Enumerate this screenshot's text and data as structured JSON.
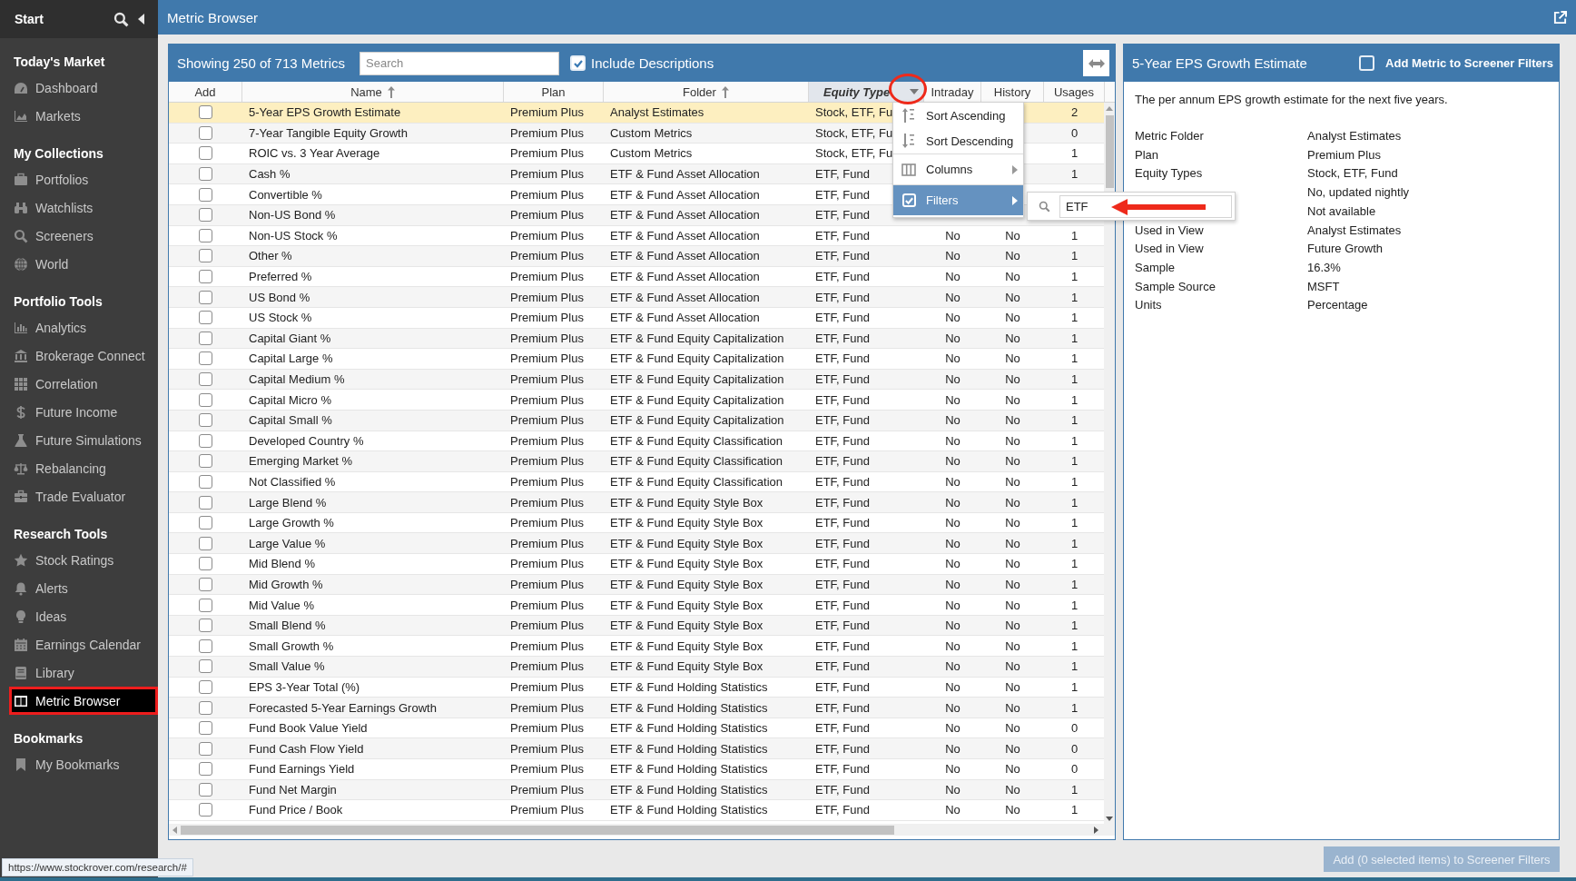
{
  "app_bar": {
    "title": "Metric Browser"
  },
  "sidebar": {
    "header": "Start",
    "sections": [
      {
        "title": "Today's Market",
        "items": [
          {
            "label": "Dashboard",
            "selected": false
          },
          {
            "label": "Markets",
            "selected": false
          }
        ]
      },
      {
        "title": "My Collections",
        "items": [
          {
            "label": "Portfolios",
            "selected": false
          },
          {
            "label": "Watchlists",
            "selected": false
          },
          {
            "label": "Screeners",
            "selected": false
          },
          {
            "label": "World",
            "selected": false
          }
        ]
      },
      {
        "title": "Portfolio Tools",
        "items": [
          {
            "label": "Analytics",
            "selected": false
          },
          {
            "label": "Brokerage Connect",
            "selected": false
          },
          {
            "label": "Correlation",
            "selected": false
          },
          {
            "label": "Future Income",
            "selected": false
          },
          {
            "label": "Future Simulations",
            "selected": false
          },
          {
            "label": "Rebalancing",
            "selected": false
          },
          {
            "label": "Trade Evaluator",
            "selected": false
          }
        ]
      },
      {
        "title": "Research Tools",
        "items": [
          {
            "label": "Stock Ratings",
            "selected": false
          },
          {
            "label": "Alerts",
            "selected": false
          },
          {
            "label": "Ideas",
            "selected": false
          },
          {
            "label": "Earnings Calendar",
            "selected": false
          },
          {
            "label": "Library",
            "selected": false
          },
          {
            "label": "Metric Browser",
            "selected": true
          }
        ]
      },
      {
        "title": "Bookmarks",
        "items": [
          {
            "label": "My Bookmarks",
            "selected": false
          }
        ]
      }
    ]
  },
  "metrics_panel": {
    "count_text": "Showing 250 of 713 Metrics",
    "search": {
      "placeholder": "Search"
    },
    "include_descriptions": {
      "label": "Include Descriptions",
      "checked": true
    },
    "columns": [
      {
        "label": "Add",
        "sorted": false,
        "active": false
      },
      {
        "label": "Name",
        "sorted": true,
        "active": false
      },
      {
        "label": "Plan",
        "sorted": false,
        "active": false
      },
      {
        "label": "Folder",
        "sorted": true,
        "active": false
      },
      {
        "label": "Equity Type",
        "sorted": false,
        "active": true
      },
      {
        "label": "Intraday",
        "sorted": false,
        "active": false
      },
      {
        "label": "History",
        "sorted": false,
        "active": false
      },
      {
        "label": "Usages",
        "sorted": false,
        "active": false
      }
    ],
    "rows": [
      {
        "checked": false,
        "selected": true,
        "name": "5-Year EPS Growth Estimate",
        "plan": "Premium Plus",
        "folder": "Analyst Estimates",
        "equity_type": "Stock, ETF, Fu",
        "usages": "2"
      },
      {
        "checked": false,
        "selected": false,
        "name": "7-Year Tangible Equity Growth",
        "plan": "Premium Plus",
        "folder": "Custom Metrics",
        "equity_type": "Stock, ETF, Fu",
        "usages": "0"
      },
      {
        "checked": false,
        "selected": false,
        "name": "ROIC vs. 3 Year Average",
        "plan": "Premium Plus",
        "folder": "Custom Metrics",
        "equity_type": "Stock, ETF, Fu",
        "usages": "1"
      },
      {
        "checked": false,
        "selected": false,
        "name": "Cash %",
        "plan": "Premium Plus",
        "folder": "ETF & Fund Asset Allocation",
        "equity_type": "ETF, Fund",
        "usages": "1"
      },
      {
        "checked": false,
        "selected": false,
        "name": "Convertible %",
        "plan": "Premium Plus",
        "folder": "ETF & Fund Asset Allocation",
        "equity_type": "ETF, Fund"
      },
      {
        "checked": false,
        "selected": false,
        "name": "Non-US Bond %",
        "plan": "Premium Plus",
        "folder": "ETF & Fund Asset Allocation",
        "equity_type": "ETF, Fund"
      },
      {
        "checked": false,
        "selected": false,
        "name": "Non-US Stock %",
        "plan": "Premium Plus",
        "folder": "ETF & Fund Asset Allocation",
        "equity_type": "ETF, Fund",
        "intraday": "No",
        "history": "No",
        "usages": "1"
      },
      {
        "checked": false,
        "selected": false,
        "name": "Other %",
        "plan": "Premium Plus",
        "folder": "ETF & Fund Asset Allocation",
        "equity_type": "ETF, Fund",
        "intraday": "No",
        "history": "No",
        "usages": "1"
      },
      {
        "checked": false,
        "selected": false,
        "name": "Preferred %",
        "plan": "Premium Plus",
        "folder": "ETF & Fund Asset Allocation",
        "equity_type": "ETF, Fund",
        "intraday": "No",
        "history": "No",
        "usages": "1"
      },
      {
        "checked": false,
        "selected": false,
        "name": "US Bond %",
        "plan": "Premium Plus",
        "folder": "ETF & Fund Asset Allocation",
        "equity_type": "ETF, Fund",
        "intraday": "No",
        "history": "No",
        "usages": "1"
      },
      {
        "checked": false,
        "selected": false,
        "name": "US Stock %",
        "plan": "Premium Plus",
        "folder": "ETF & Fund Asset Allocation",
        "equity_type": "ETF, Fund",
        "intraday": "No",
        "history": "No",
        "usages": "1"
      },
      {
        "checked": false,
        "selected": false,
        "name": "Capital Giant %",
        "plan": "Premium Plus",
        "folder": "ETF & Fund Equity Capitalization",
        "equity_type": "ETF, Fund",
        "intraday": "No",
        "history": "No",
        "usages": "1"
      },
      {
        "checked": false,
        "selected": false,
        "name": "Capital Large %",
        "plan": "Premium Plus",
        "folder": "ETF & Fund Equity Capitalization",
        "equity_type": "ETF, Fund",
        "intraday": "No",
        "history": "No",
        "usages": "1"
      },
      {
        "checked": false,
        "selected": false,
        "name": "Capital Medium %",
        "plan": "Premium Plus",
        "folder": "ETF & Fund Equity Capitalization",
        "equity_type": "ETF, Fund",
        "intraday": "No",
        "history": "No",
        "usages": "1"
      },
      {
        "checked": false,
        "selected": false,
        "name": "Capital Micro %",
        "plan": "Premium Plus",
        "folder": "ETF & Fund Equity Capitalization",
        "equity_type": "ETF, Fund",
        "intraday": "No",
        "history": "No",
        "usages": "1"
      },
      {
        "checked": false,
        "selected": false,
        "name": "Capital Small %",
        "plan": "Premium Plus",
        "folder": "ETF & Fund Equity Capitalization",
        "equity_type": "ETF, Fund",
        "intraday": "No",
        "history": "No",
        "usages": "1"
      },
      {
        "checked": false,
        "selected": false,
        "name": "Developed Country %",
        "plan": "Premium Plus",
        "folder": "ETF & Fund Equity Classification",
        "equity_type": "ETF, Fund",
        "intraday": "No",
        "history": "No",
        "usages": "1"
      },
      {
        "checked": false,
        "selected": false,
        "name": "Emerging Market %",
        "plan": "Premium Plus",
        "folder": "ETF & Fund Equity Classification",
        "equity_type": "ETF, Fund",
        "intraday": "No",
        "history": "No",
        "usages": "1"
      },
      {
        "checked": false,
        "selected": false,
        "name": "Not Classified %",
        "plan": "Premium Plus",
        "folder": "ETF & Fund Equity Classification",
        "equity_type": "ETF, Fund",
        "intraday": "No",
        "history": "No",
        "usages": "1"
      },
      {
        "checked": false,
        "selected": false,
        "name": "Large Blend %",
        "plan": "Premium Plus",
        "folder": "ETF & Fund Equity Style Box",
        "equity_type": "ETF, Fund",
        "intraday": "No",
        "history": "No",
        "usages": "1"
      },
      {
        "checked": false,
        "selected": false,
        "name": "Large Growth %",
        "plan": "Premium Plus",
        "folder": "ETF & Fund Equity Style Box",
        "equity_type": "ETF, Fund",
        "intraday": "No",
        "history": "No",
        "usages": "1"
      },
      {
        "checked": false,
        "selected": false,
        "name": "Large Value %",
        "plan": "Premium Plus",
        "folder": "ETF & Fund Equity Style Box",
        "equity_type": "ETF, Fund",
        "intraday": "No",
        "history": "No",
        "usages": "1"
      },
      {
        "checked": false,
        "selected": false,
        "name": "Mid Blend %",
        "plan": "Premium Plus",
        "folder": "ETF & Fund Equity Style Box",
        "equity_type": "ETF, Fund",
        "intraday": "No",
        "history": "No",
        "usages": "1"
      },
      {
        "checked": false,
        "selected": false,
        "name": "Mid Growth %",
        "plan": "Premium Plus",
        "folder": "ETF & Fund Equity Style Box",
        "equity_type": "ETF, Fund",
        "intraday": "No",
        "history": "No",
        "usages": "1"
      },
      {
        "checked": false,
        "selected": false,
        "name": "Mid Value %",
        "plan": "Premium Plus",
        "folder": "ETF & Fund Equity Style Box",
        "equity_type": "ETF, Fund",
        "intraday": "No",
        "history": "No",
        "usages": "1"
      },
      {
        "checked": false,
        "selected": false,
        "name": "Small Blend %",
        "plan": "Premium Plus",
        "folder": "ETF & Fund Equity Style Box",
        "equity_type": "ETF, Fund",
        "intraday": "No",
        "history": "No",
        "usages": "1"
      },
      {
        "checked": false,
        "selected": false,
        "name": "Small Growth %",
        "plan": "Premium Plus",
        "folder": "ETF & Fund Equity Style Box",
        "equity_type": "ETF, Fund",
        "intraday": "No",
        "history": "No",
        "usages": "1"
      },
      {
        "checked": false,
        "selected": false,
        "name": "Small Value %",
        "plan": "Premium Plus",
        "folder": "ETF & Fund Equity Style Box",
        "equity_type": "ETF, Fund",
        "intraday": "No",
        "history": "No",
        "usages": "1"
      },
      {
        "checked": false,
        "selected": false,
        "name": "EPS 3-Year Total (%)",
        "plan": "Premium Plus",
        "folder": "ETF & Fund Holding Statistics",
        "equity_type": "ETF, Fund",
        "intraday": "No",
        "history": "No",
        "usages": "1"
      },
      {
        "checked": false,
        "selected": false,
        "name": "Forecasted 5-Year Earnings Growth",
        "plan": "Premium Plus",
        "folder": "ETF & Fund Holding Statistics",
        "equity_type": "ETF, Fund",
        "intraday": "No",
        "history": "No",
        "usages": "1"
      },
      {
        "checked": false,
        "selected": false,
        "name": "Fund Book Value Yield",
        "plan": "Premium Plus",
        "folder": "ETF & Fund Holding Statistics",
        "equity_type": "ETF, Fund",
        "intraday": "No",
        "history": "No",
        "usages": "0"
      },
      {
        "checked": false,
        "selected": false,
        "name": "Fund Cash Flow Yield",
        "plan": "Premium Plus",
        "folder": "ETF & Fund Holding Statistics",
        "equity_type": "ETF, Fund",
        "intraday": "No",
        "history": "No",
        "usages": "0"
      },
      {
        "checked": false,
        "selected": false,
        "name": "Fund Earnings Yield",
        "plan": "Premium Plus",
        "folder": "ETF & Fund Holding Statistics",
        "equity_type": "ETF, Fund",
        "intraday": "No",
        "history": "No",
        "usages": "0"
      },
      {
        "checked": false,
        "selected": false,
        "name": "Fund Net Margin",
        "plan": "Premium Plus",
        "folder": "ETF & Fund Holding Statistics",
        "equity_type": "ETF, Fund",
        "intraday": "No",
        "history": "No",
        "usages": "1"
      },
      {
        "checked": false,
        "selected": false,
        "name": "Fund Price / Book",
        "plan": "Premium Plus",
        "folder": "ETF & Fund Holding Statistics",
        "equity_type": "ETF, Fund",
        "intraday": "No",
        "history": "No",
        "usages": "1"
      }
    ],
    "column_menu": {
      "items": [
        {
          "label": "Sort Ascending",
          "kind": "sort-ascending",
          "selected": false
        },
        {
          "label": "Sort Descending",
          "kind": "sort-descending",
          "selected": false
        },
        {
          "label": "Columns",
          "kind": "columns",
          "selected": false
        },
        {
          "label": "Filters",
          "kind": "filters",
          "selected": true,
          "checked": true
        }
      ],
      "filter": {
        "value": "ETF"
      }
    }
  },
  "detail_panel": {
    "title": "5-Year EPS Growth Estimate",
    "add_to_filters": {
      "label": "Add Metric to Screener Filters",
      "checked": false
    },
    "description": "The per annum EPS growth estimate for the next five years.",
    "fields": [
      {
        "label": "Metric Folder",
        "value": "Analyst Estimates"
      },
      {
        "label": "Plan",
        "value": "Premium Plus"
      },
      {
        "label": "Equity Types",
        "value": "Stock, ETF, Fund"
      },
      {
        "value": "No, updated nightly"
      },
      {
        "value": "Not available"
      },
      {
        "label": "Used in View",
        "value": "Analyst Estimates"
      },
      {
        "label": "Used in View",
        "value": "Future Growth"
      },
      {
        "label": "Sample",
        "value": "16.3%"
      },
      {
        "label": "Sample Source",
        "value": "MSFT"
      },
      {
        "label": "Units",
        "value": "Percentage"
      }
    ]
  },
  "footer_button": {
    "label": "Add (0 selected items) to Screener Filters",
    "disabled": true
  },
  "status_url": "https://www.stockrover.com/research/#"
}
